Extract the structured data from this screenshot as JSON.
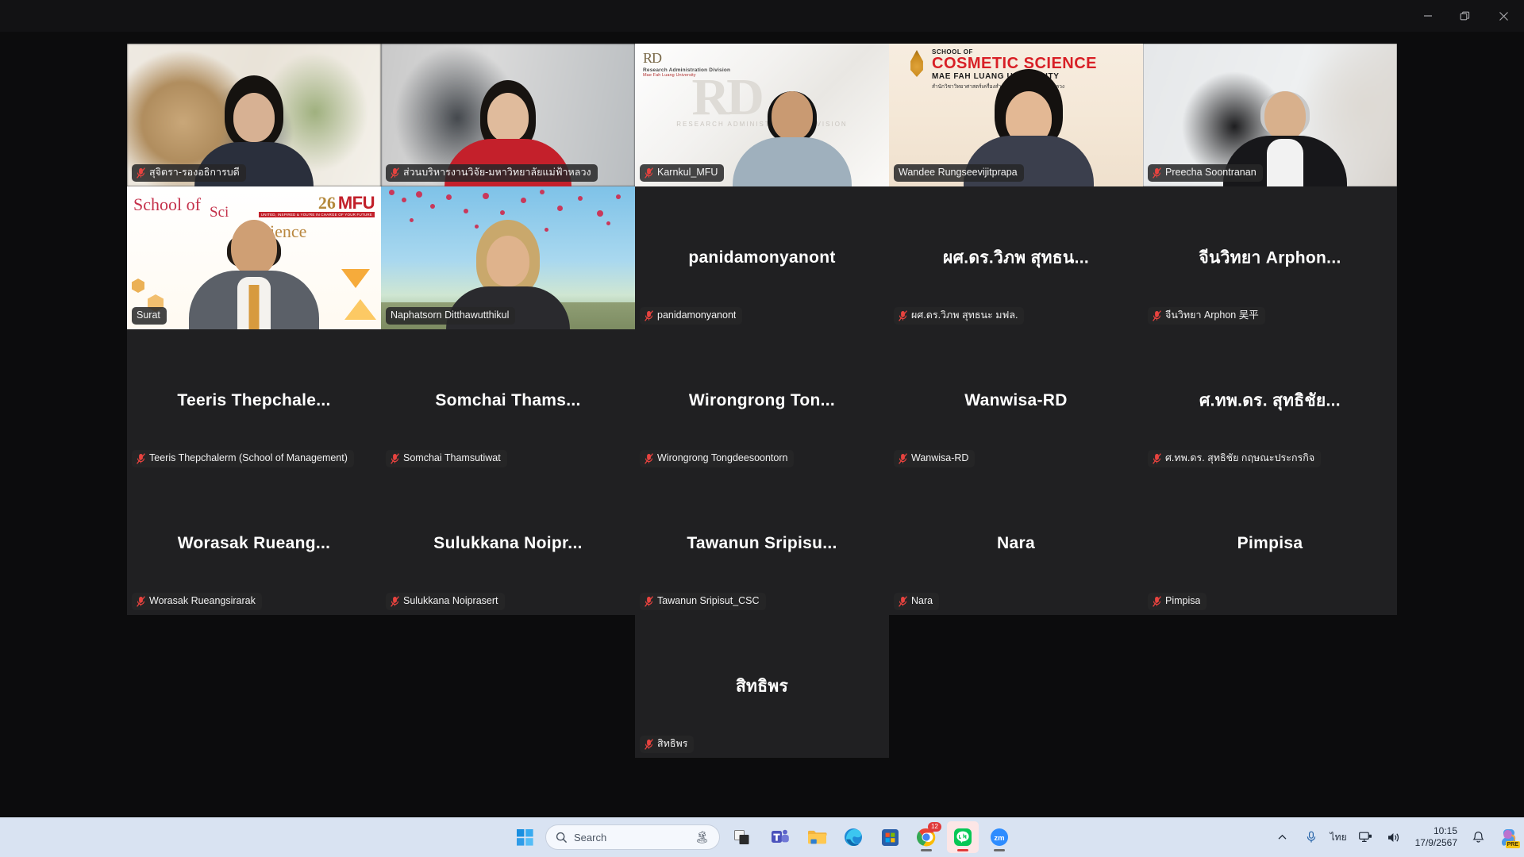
{
  "window": {
    "controls": [
      {
        "name": "minimize",
        "glyph": "minimize"
      },
      {
        "name": "restore",
        "glyph": "restore"
      },
      {
        "name": "close",
        "glyph": "close"
      }
    ]
  },
  "colors": {
    "active_speaker": "#35e06a",
    "muted_icon": "#e8433f",
    "tile_bg": "#202022",
    "app_bg": "#0c0c0d",
    "taskbar_bg": "#d9e3f2"
  },
  "gallery": {
    "rows": [
      [
        {
          "label": "สุจิตรา-รองอธิการบดี",
          "muted": true,
          "video": true,
          "bg": "office",
          "active": false,
          "placeholder": ""
        },
        {
          "label": "ส่วนบริหารงานวิจัย-มหาวิทยาลัยแม่ฟ้าหลวง",
          "muted": true,
          "video": true,
          "bg": "room-red",
          "active": false,
          "placeholder": ""
        },
        {
          "label": "Karnkul_MFU",
          "muted": true,
          "video": true,
          "bg": "rd",
          "active": false,
          "placeholder": ""
        },
        {
          "label": "Wandee Rungseevijitprapa",
          "muted": false,
          "video": true,
          "bg": "cosmetic",
          "active": true,
          "placeholder": ""
        },
        {
          "label": "Preecha Soontranan",
          "muted": true,
          "video": true,
          "bg": "white-room",
          "active": false,
          "placeholder": ""
        }
      ],
      [
        {
          "label": "Surat",
          "muted": false,
          "video": true,
          "bg": "sci",
          "active": false,
          "placeholder": ""
        },
        {
          "label": "Naphatsorn Ditthawutthikul",
          "muted": false,
          "video": true,
          "bg": "sakura",
          "active": false,
          "placeholder": ""
        },
        {
          "label": "panidamonyanont",
          "muted": true,
          "video": false,
          "bg": "",
          "active": false,
          "placeholder": "panidamonyanont"
        },
        {
          "label": "ผศ.ดร.วิภพ สุทธนะ มฟล.",
          "muted": true,
          "video": false,
          "bg": "",
          "active": false,
          "placeholder": "ผศ.ดร.วิภพ สุทธน..."
        },
        {
          "label": "จีนวิทยา Arphon 吴平",
          "muted": true,
          "video": false,
          "bg": "",
          "active": false,
          "placeholder": "จีนวิทยา Arphon..."
        }
      ],
      [
        {
          "label": "Teeris Thepchalerm (School of Management)",
          "muted": true,
          "video": false,
          "bg": "",
          "active": false,
          "placeholder": "Teeris Thepchale..."
        },
        {
          "label": "Somchai Thamsutiwat",
          "muted": true,
          "video": false,
          "bg": "",
          "active": false,
          "placeholder": "Somchai Thams..."
        },
        {
          "label": "Wirongrong Tongdeesoontorn",
          "muted": true,
          "video": false,
          "bg": "",
          "active": false,
          "placeholder": "Wirongrong Ton..."
        },
        {
          "label": "Wanwisa-RD",
          "muted": true,
          "video": false,
          "bg": "",
          "active": false,
          "placeholder": "Wanwisa-RD"
        },
        {
          "label": "ศ.ทพ.ดร. สุทธิชัย กฤษณะประกรกิจ",
          "muted": true,
          "video": false,
          "bg": "",
          "active": false,
          "placeholder": "ศ.ทพ.ดร. สุทธิชัย..."
        }
      ],
      [
        {
          "label": "Worasak Rueangsirarak",
          "muted": true,
          "video": false,
          "bg": "",
          "active": false,
          "placeholder": "Worasak Rueang..."
        },
        {
          "label": "Sulukkana Noiprasert",
          "muted": true,
          "video": false,
          "bg": "",
          "active": false,
          "placeholder": "Sulukkana Noipr..."
        },
        {
          "label": "Tawanun Sripisut_CSC",
          "muted": true,
          "video": false,
          "bg": "",
          "active": false,
          "placeholder": "Tawanun Sripisu..."
        },
        {
          "label": "Nara",
          "muted": true,
          "video": false,
          "bg": "",
          "active": false,
          "placeholder": "Nara"
        },
        {
          "label": "Pimpisa",
          "muted": true,
          "video": false,
          "bg": "",
          "active": false,
          "placeholder": "Pimpisa"
        }
      ]
    ],
    "last_row": [
      {
        "label": "สิทธิพร",
        "muted": true,
        "video": false,
        "bg": "",
        "active": false,
        "placeholder": "สิทธิพร"
      }
    ]
  },
  "video_overlays": {
    "rd": {
      "mark": "RD",
      "line1": "Research Administration Division",
      "line2": "Mae Fah Luang University",
      "watermark": "RD",
      "watermark_sub": "RESEARCH ADMINISTRATION DIVISION"
    },
    "cosmetic": {
      "line1": "SCHOOL OF",
      "line2": "COSMETIC  SCIENCE",
      "line3": "MAE FAH LUANG UNIVERSITY",
      "line4": "สำนักวิชาวิทยาศาสตร์เครื่องสำอาง มหาวิทยาลัยแม่ฟ้าหลวง"
    },
    "science": {
      "word1": "School of",
      "word2": "Sci",
      "word3": "ience",
      "mfu_num": "26",
      "mfu_letters": "MFU",
      "mfu_tagline": "UNITED, INSPIRED & YOU'RE IN CHARGE OF YOUR FUTURE"
    }
  },
  "taskbar": {
    "start": {
      "name": "start-button"
    },
    "search": {
      "placeholder": "Search",
      "icon": "search-icon"
    },
    "items": [
      {
        "name": "task-view",
        "label": "Task View",
        "active": false,
        "running": false
      },
      {
        "name": "microsoft-teams",
        "label": "Microsoft Teams",
        "active": false,
        "running": false
      },
      {
        "name": "file-explorer",
        "label": "File Explorer",
        "active": false,
        "running": false
      },
      {
        "name": "microsoft-edge",
        "label": "Microsoft Edge",
        "active": false,
        "running": false
      },
      {
        "name": "microsoft-store",
        "label": "Microsoft Store",
        "active": false,
        "running": false
      },
      {
        "name": "google-chrome",
        "label": "Google Chrome",
        "active": false,
        "running": true,
        "badge": "12"
      },
      {
        "name": "line",
        "label": "LINE",
        "active": true,
        "running": true
      },
      {
        "name": "zoom",
        "label": "Zoom",
        "active": false,
        "running": true
      }
    ],
    "tray": {
      "overflow": "show-hidden-icons",
      "microphone": "microphone-icon",
      "language": "ไทย",
      "network": "network-icon",
      "volume": "volume-icon",
      "time": "10:15",
      "date": "17/9/2567",
      "notifications": "bell-icon",
      "copilot_badge": "PRE"
    }
  }
}
